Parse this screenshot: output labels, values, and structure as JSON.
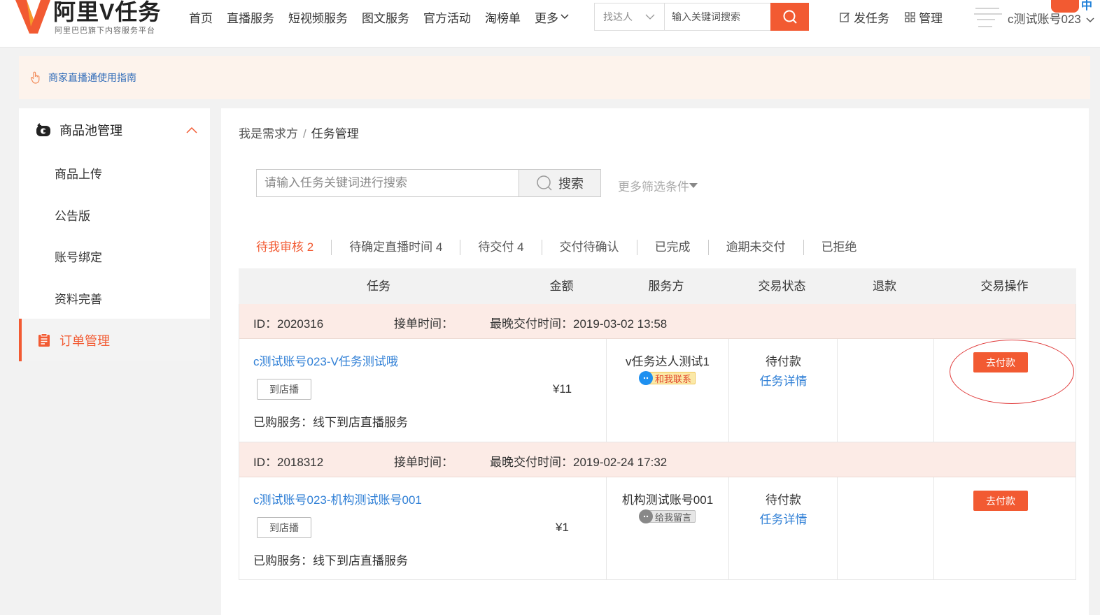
{
  "brand": {
    "title": "阿里V任务",
    "subtitle": "阿里巴巴旗下内容服务平台",
    "color": "#f25a32"
  },
  "nav": {
    "items": [
      "首页",
      "直播服务",
      "短视频服务",
      "图文服务",
      "官方活动",
      "淘榜单",
      "更多"
    ]
  },
  "search": {
    "select_value": "找达人",
    "placeholder": "输入关键词搜索"
  },
  "header_right": {
    "post_task": "发任务",
    "manage": "管理",
    "account": "c测试账号023",
    "corner_text": "中"
  },
  "notice": {
    "link": "商家直播通使用指南"
  },
  "sidebar": {
    "group_label": "商品池管理",
    "items": [
      "商品上传",
      "公告版",
      "账号绑定",
      "资料完善"
    ],
    "active_label": "订单管理"
  },
  "breadcrumb": {
    "parent": "我是需求方",
    "separator": "/",
    "current": "任务管理"
  },
  "task_search": {
    "placeholder": "请输入任务关键词进行搜索",
    "button": "搜索",
    "more_filter": "更多筛选条件"
  },
  "tabs": [
    "待我审核 2",
    "待确定直播时间 4",
    "待交付 4",
    "交付待确认",
    "已完成",
    "逾期未交付",
    "已拒绝"
  ],
  "table": {
    "headers": [
      "任务",
      "金额",
      "服务方",
      "交易状态",
      "退款",
      "交易操作"
    ],
    "orders": [
      {
        "id": "ID：2020316",
        "accept_time": "接单时间：",
        "deadline": "最晚交付时间：2019-03-02 13:58",
        "task_title": "c测试账号023-V任务测试哦",
        "tag": "到店播",
        "bought": "已购服务：线下到店直播服务",
        "amount": "¥11",
        "provider": "v任务达人测试1",
        "contact": "和我联系",
        "status": "待付款",
        "detail": "任务详情",
        "action": "去付款"
      },
      {
        "id": "ID：2018312",
        "accept_time": "接单时间：",
        "deadline": "最晚交付时间：2019-02-24 17:32",
        "task_title": "c测试账号023-机构测试账号001",
        "tag": "到店播",
        "bought": "已购服务：线下到店直播服务",
        "amount": "¥1",
        "provider": "机构测试账号001",
        "contact": "给我留言",
        "status": "待付款",
        "detail": "任务详情",
        "action": "去付款"
      }
    ]
  }
}
